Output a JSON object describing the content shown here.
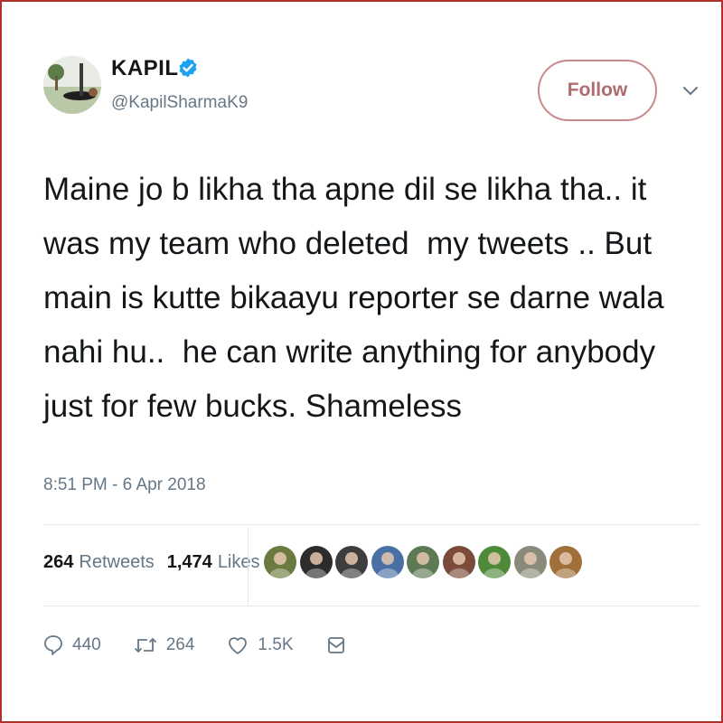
{
  "user": {
    "name": "KAPIL",
    "handle": "@KapilSharmaK9",
    "verified_color": "#1da1f2"
  },
  "follow_label": "Follow",
  "tweet": {
    "lines": [
      "Maine jo b likha tha apne dil se likha tha.. it",
      "was my team who deleted  my tweets .. But",
      "main is kutte bikaayu reporter se darne wala",
      "nahi hu..  he can write anything for anybody",
      "just for few bucks. Shameless"
    ],
    "timestamp": "8:51 PM - 6 Apr 2018"
  },
  "stats": {
    "retweets_count": "264",
    "retweets_label": "Retweets",
    "likes_count": "1,474",
    "likes_label": "Likes"
  },
  "likers": [
    {
      "icon": "liker-avatar",
      "color": "#6b7a3e"
    },
    {
      "icon": "liker-avatar",
      "color": "#2c2c2c"
    },
    {
      "icon": "liker-avatar",
      "color": "#3d3d3d"
    },
    {
      "icon": "liker-avatar",
      "color": "#4a6fa5"
    },
    {
      "icon": "liker-avatar",
      "color": "#5d7a55"
    },
    {
      "icon": "liker-avatar",
      "color": "#7a4a3a"
    },
    {
      "icon": "liker-avatar",
      "color": "#4f8a3a"
    },
    {
      "icon": "liker-avatar",
      "color": "#8a8a7a"
    },
    {
      "icon": "liker-avatar",
      "color": "#a0703a"
    }
  ],
  "actions": {
    "reply_count": "440",
    "retweet_count": "264",
    "like_count": "1.5K"
  }
}
